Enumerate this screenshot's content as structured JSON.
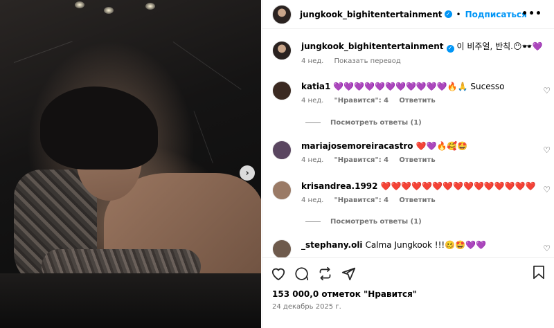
{
  "post": {
    "author": "jungkook_bighitentertainment",
    "follow_label": "Подписаться",
    "more_label": "•••"
  },
  "caption": {
    "author": "jungkook_bighitentertainment",
    "text": "이 비주얼, 반칙.😶🕶️💜",
    "time": "4 нед.",
    "translate_label": "Показать перевод"
  },
  "comments": [
    {
      "author": "katia1",
      "text": "💜💜💜💜💜💜💜💜💜💜💜🔥🙏 Sucesso",
      "time": "4 нед.",
      "likes": "\"Нравится\": 4",
      "reply_label": "Ответить",
      "view_replies": "Посмотреть ответы (1)",
      "avatar_color": "#3b2a22"
    },
    {
      "author": "mariajosemoreiracastro",
      "text": "❤️💜🔥🥰🤩",
      "time": "4 нед.",
      "likes": "\"Нравится\": 4",
      "reply_label": "Ответить",
      "avatar_color": "#5a4660"
    },
    {
      "author": "krisandrea.1992",
      "text": "❤️❤️❤️❤️❤️❤️❤️❤️❤️❤️❤️❤️❤️❤️❤️",
      "time": "4 нед.",
      "likes": "\"Нравится\": 4",
      "reply_label": "Ответить",
      "view_replies": "Посмотреть ответы (1)",
      "avatar_color": "#9a7a66"
    },
    {
      "author": "_stephany.oli",
      "text": "Calma Jungkook !!!🥴🤩💜💜",
      "avatar_color": "#6e5a4c"
    }
  ],
  "footer": {
    "likes": "153 000,0 отметок \"Нравится\"",
    "date": "24 декабрь 2025 г."
  },
  "icons": {
    "like": "heart-icon",
    "comment": "comment-icon",
    "repost": "repost-icon",
    "share": "share-icon",
    "save": "bookmark-icon",
    "next": "chevron-right-icon",
    "comment_like": "heart-outline-icon"
  },
  "colors": {
    "accent": "#0095f6",
    "muted": "#737373"
  }
}
